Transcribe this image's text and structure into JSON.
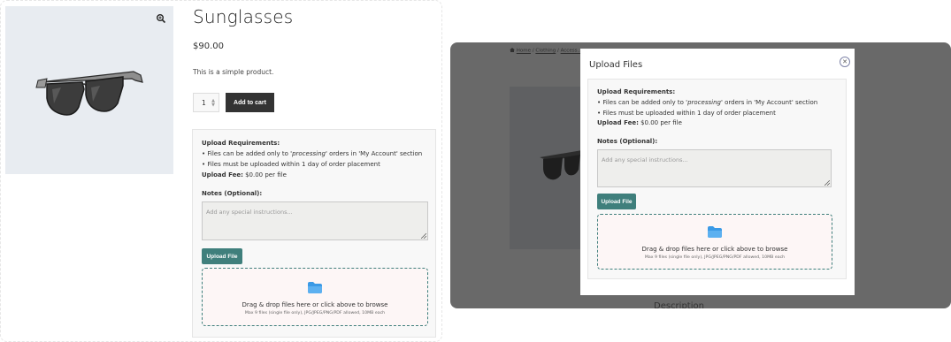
{
  "product": {
    "title": "Sunglasses",
    "price": "$90.00",
    "description": "This is a simple product.",
    "quantity": "1",
    "add_to_cart_label": "Add to cart"
  },
  "upload": {
    "requirements_title": "Upload Requirements:",
    "req_line1_prefix": "• Files can be added only to '",
    "req_line1_status": "processing",
    "req_line1_suffix": "' orders in 'My Account' section",
    "req_line2": "• Files must be uploaded within 1 day of order placement",
    "fee_label": "Upload Fee:",
    "fee_value": " $0.00 per file",
    "notes_label": "Notes (Optional):",
    "notes_placeholder": "Add any special instructions...",
    "upload_button_label": "Upload File",
    "drop_text": "Drag & drop files here or click above to browse",
    "drop_subtext": "Max 9 files (single file only), JPG/JPEG/PNG/PDF allowed, 10MB each"
  },
  "modal": {
    "title": "Upload Files",
    "close_glyph": "✕"
  },
  "background_page": {
    "breadcrumb_home": "Home",
    "breadcrumb_sep": "/",
    "breadcrumb_clothing": "Clothing",
    "breadcrumb_accessories": "Access...",
    "description_heading": "Description"
  },
  "colors": {
    "accent": "#3f7f7c",
    "cart_button": "#333333",
    "overlay": "#696969",
    "folder": "#3b9ae6"
  }
}
